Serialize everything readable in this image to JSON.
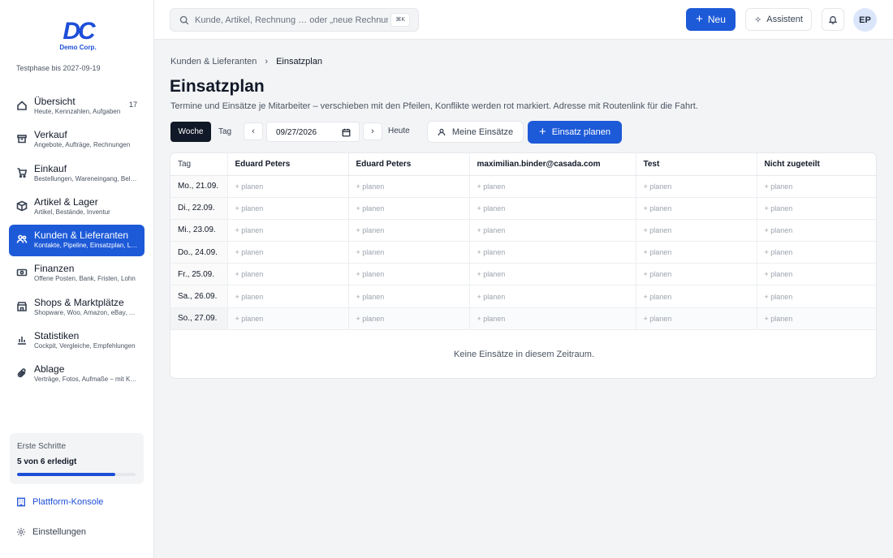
{
  "brand": {
    "logo_text": "Demo Corp.",
    "trial": "Testphase bis 2027-09-19"
  },
  "sidebar": {
    "items": [
      {
        "label": "Übersicht",
        "sub": "Heute, Kennzahlen, Aufgaben",
        "badge": "17",
        "icon": "home-icon"
      },
      {
        "label": "Verkauf",
        "sub": "Angebote, Aufträge, Rechnungen",
        "icon": "archive-icon"
      },
      {
        "label": "Einkauf",
        "sub": "Bestellungen, Wareneingang, Belege",
        "icon": "cart-icon"
      },
      {
        "label": "Artikel & Lager",
        "sub": "Artikel, Bestände, Inventur",
        "icon": "box-icon"
      },
      {
        "label": "Kunden & Lieferanten",
        "sub": "Kontakte, Pipeline, Einsatzplan, Lieferanten",
        "icon": "users-icon",
        "active": true
      },
      {
        "label": "Finanzen",
        "sub": "Offene Posten, Bank, Fristen, Lohn",
        "icon": "money-icon"
      },
      {
        "label": "Shops & Marktplätze",
        "sub": "Shopware, Woo, Amazon, eBay, Otto",
        "icon": "shop-icon"
      },
      {
        "label": "Statistiken",
        "sub": "Cockpit, Vergleiche, Empfehlungen",
        "icon": "chart-icon"
      },
      {
        "label": "Ablage",
        "sub": "Verträge, Fotos, Aufmaße – mit Kunden",
        "icon": "paperclip-icon"
      }
    ],
    "steps": {
      "title": "Erste Schritte",
      "count": "5 von 6 erledigt",
      "progress": 0.83
    },
    "platform": "Plattform-Konsole",
    "settings": "Einstellungen"
  },
  "topbar": {
    "search_placeholder": "Kunde, Artikel, Rechnung … oder „neue Rechnung“",
    "shortcut": "⌘K",
    "new_label": "Neu",
    "assistant_label": "Assistent",
    "avatar": "EP"
  },
  "breadcrumb": {
    "parent": "Kunden & Lieferanten",
    "current": "Einsatzplan"
  },
  "page": {
    "title": "Einsatzplan",
    "subtitle": "Termine und Einsätze je Mitarbeiter – verschieben mit den Pfeilen, Konflikte werden rot markiert. Adresse mit Routenlink für die Fahrt."
  },
  "toolbar": {
    "view_week": "Woche",
    "view_day": "Tag",
    "prev": "‹",
    "next": "›",
    "date": "09/27/2026",
    "today": "Heute",
    "mine": "Meine Einsätze",
    "plan": "Einsatz planen"
  },
  "schedule": {
    "day_header": "Tag",
    "columns": [
      "Eduard Peters",
      "Eduard Peters",
      "maximilian.binder@casada.com",
      "Test",
      "Nicht zugeteilt"
    ],
    "days": [
      "Mo., 21.09.",
      "Di., 22.09.",
      "Mi., 23.09.",
      "Do., 24.09.",
      "Fr., 25.09.",
      "Sa., 26.09.",
      "So., 27.09."
    ],
    "cell_label": "+ planen",
    "empty": "Keine Einsätze in diesem Zeitraum."
  },
  "colors": {
    "accent": "#1d5ad8",
    "dark": "#111827"
  }
}
